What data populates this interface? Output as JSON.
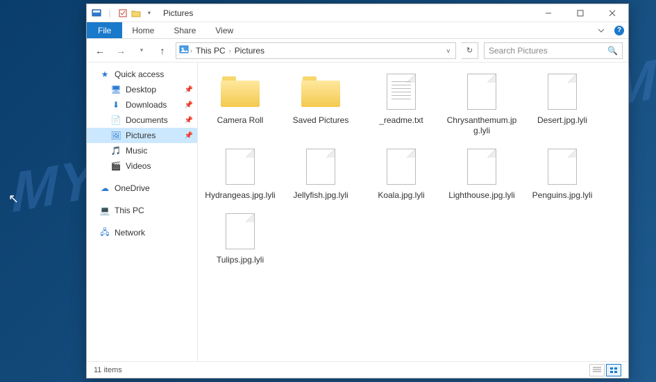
{
  "window": {
    "title": "Pictures"
  },
  "ribbon": {
    "file": "File",
    "tabs": [
      "Home",
      "Share",
      "View"
    ]
  },
  "address": {
    "crumbs": [
      "This PC",
      "Pictures"
    ]
  },
  "search": {
    "placeholder": "Search Pictures"
  },
  "sidebar": {
    "quick_access": "Quick access",
    "quick_items": [
      {
        "label": "Desktop",
        "icon": "desktop",
        "pinned": true
      },
      {
        "label": "Downloads",
        "icon": "downloads",
        "pinned": true
      },
      {
        "label": "Documents",
        "icon": "documents",
        "pinned": true
      },
      {
        "label": "Pictures",
        "icon": "pictures",
        "pinned": true,
        "selected": true
      },
      {
        "label": "Music",
        "icon": "music",
        "pinned": false
      },
      {
        "label": "Videos",
        "icon": "videos",
        "pinned": false
      }
    ],
    "onedrive": "OneDrive",
    "thispc": "This PC",
    "network": "Network"
  },
  "files": [
    {
      "name": "Camera Roll",
      "type": "folder"
    },
    {
      "name": "Saved Pictures",
      "type": "folder"
    },
    {
      "name": "_readme.txt",
      "type": "text"
    },
    {
      "name": "Chrysanthemum.jpg.lyli",
      "type": "file"
    },
    {
      "name": "Desert.jpg.lyli",
      "type": "file"
    },
    {
      "name": "Hydrangeas.jpg.lyli",
      "type": "file"
    },
    {
      "name": "Jellyfish.jpg.lyli",
      "type": "file"
    },
    {
      "name": "Koala.jpg.lyli",
      "type": "file"
    },
    {
      "name": "Lighthouse.jpg.lyli",
      "type": "file"
    },
    {
      "name": "Penguins.jpg.lyli",
      "type": "file"
    },
    {
      "name": "Tulips.jpg.lyli",
      "type": "file"
    }
  ],
  "status": {
    "count_label": "11 items"
  },
  "watermark": "MYANTISPYWARE.COM",
  "colors": {
    "accent": "#1979ca",
    "selection": "#cce8ff"
  },
  "icons": {
    "desktop": "🖥",
    "downloads": "⬇",
    "documents": "📄",
    "pictures": "🖼",
    "music": "🎵",
    "videos": "🎬",
    "onedrive": "☁",
    "thispc": "💻",
    "network": "🖧",
    "star": "★",
    "pin": "📌"
  }
}
